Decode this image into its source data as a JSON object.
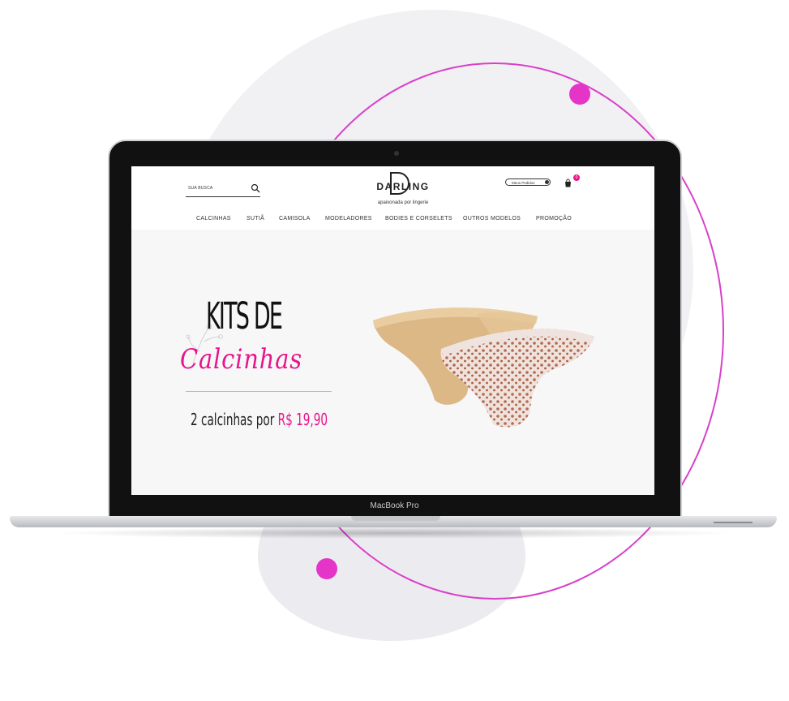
{
  "colors": {
    "accent": "#e8148c",
    "orbit": "#d93fc9"
  },
  "laptop": {
    "model_label": "MacBook Pro"
  },
  "site": {
    "search": {
      "placeholder": "SUA BUSCA",
      "icon": "search-icon"
    },
    "logo": {
      "name": "DARLING",
      "tagline": "apaixonada por lingerie"
    },
    "account": {
      "orders_label": "Meus Pedidos",
      "icon": "user-icon"
    },
    "cart": {
      "icon": "cart-icon",
      "count": "0"
    },
    "nav": [
      "CALCINHAS",
      "SUTIÃ",
      "CAMISOLA",
      "MODELADORES",
      "BODIES E CORSELETS",
      "OUTROS MODELOS",
      "PROMOÇÃO"
    ],
    "banner": {
      "headline": "KITS DE",
      "script": "Calcinhas",
      "offer_prefix": "2 calcinhas por ",
      "offer_price": "R$ 19,90"
    }
  }
}
